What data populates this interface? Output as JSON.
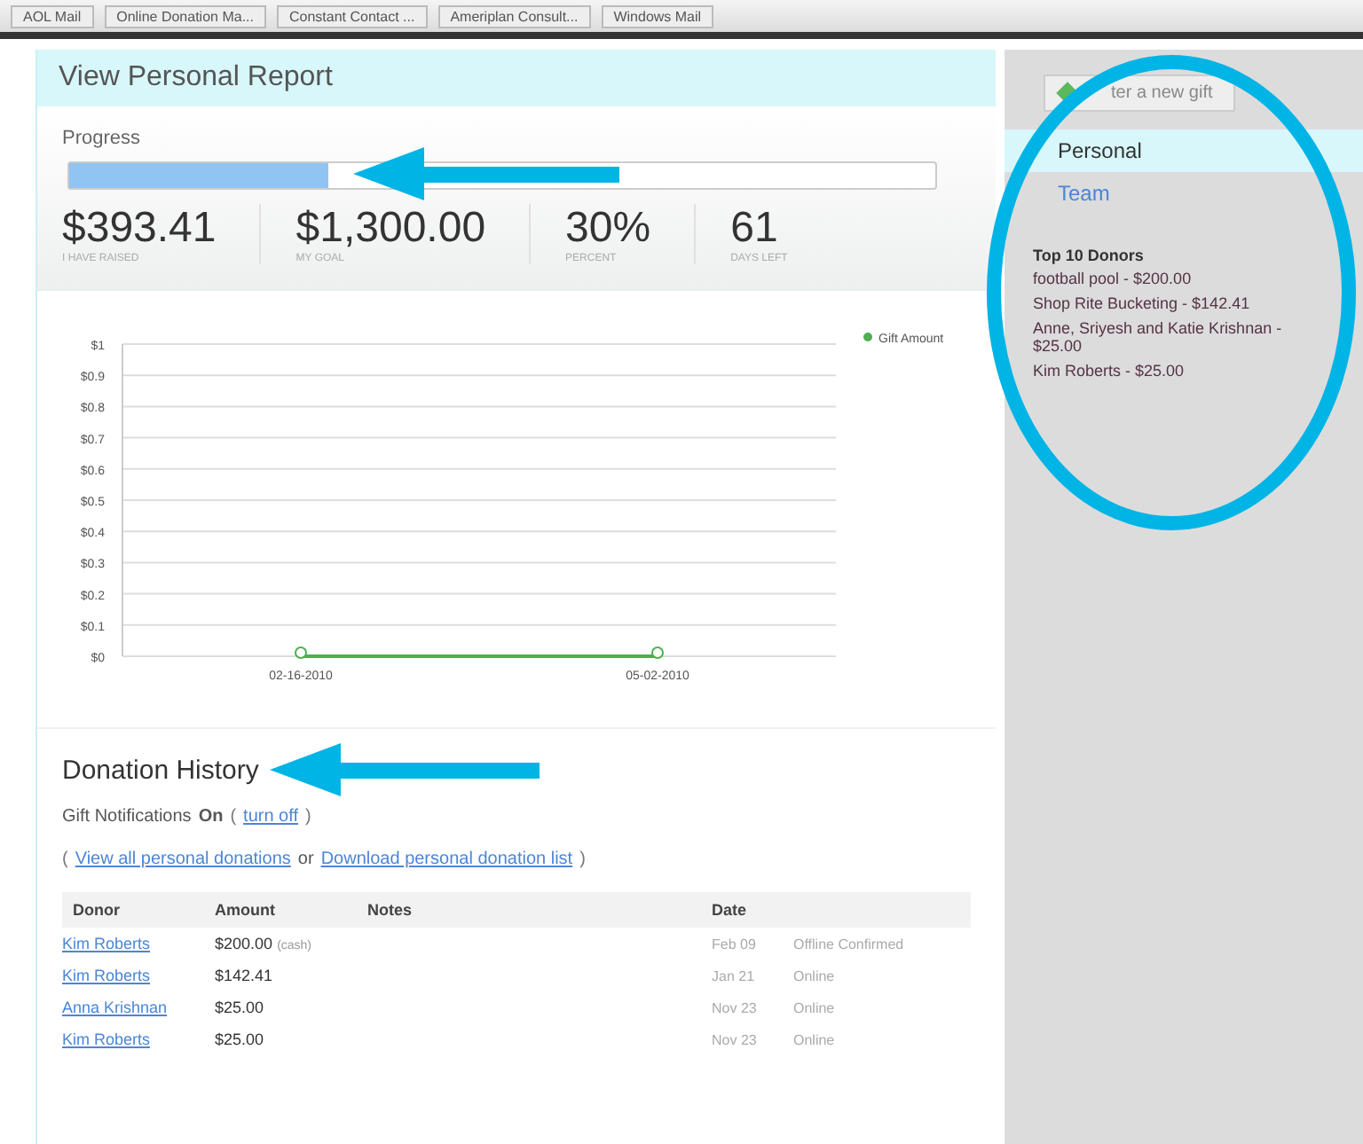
{
  "taskbar": {
    "tabs": [
      {
        "label": "AOL Mail"
      },
      {
        "label": "Online Donation Ma..."
      },
      {
        "label": "Constant Contact ..."
      },
      {
        "label": "Ameriplan Consult..."
      },
      {
        "label": "Windows Mail"
      }
    ]
  },
  "report": {
    "title": "View Personal Report",
    "progress_label": "Progress",
    "level": 0.3,
    "stats": [
      {
        "value": "$393.41",
        "label": "I HAVE RAISED"
      },
      {
        "value": "$1,300.00",
        "label": "MY GOAL"
      },
      {
        "value": "30%",
        "label": "PERCENT"
      },
      {
        "value": "61",
        "label": "DAYS LEFT"
      }
    ]
  },
  "chart": {
    "chart_data": {
      "type": "line",
      "grid": true,
      "categories": [
        "02-16-2010",
        "05-02-2010"
      ],
      "ylim": [
        0,
        1
      ],
      "yticks": [
        {
          "value": 0,
          "label": "$0"
        },
        {
          "value": 0.1,
          "label": "$0.1"
        },
        {
          "value": 0.2,
          "label": "$0.2"
        },
        {
          "value": 0.3,
          "label": "$0.3"
        },
        {
          "value": 0.4,
          "label": "$0.4"
        },
        {
          "value": 0.5,
          "label": "$0.5"
        },
        {
          "value": 0.6,
          "label": "$0.6"
        },
        {
          "value": 0.7,
          "label": "$0.7"
        },
        {
          "value": 0.8,
          "label": "$0.8"
        },
        {
          "value": 0.9,
          "label": "$0.9"
        },
        {
          "value": 1,
          "label": "$1"
        }
      ],
      "series": [
        {
          "name": "Gift Amount",
          "color": "#4caf50",
          "values": [
            0,
            0
          ]
        }
      ]
    }
  },
  "donation_history": {
    "title": "Donation History",
    "notifications_label": "Gift Notifications",
    "notifications_state": "On",
    "turn_off_open": "(",
    "turn_off_link": "turn off",
    "turn_off_close": ")",
    "links_open": "(",
    "links_close": ")",
    "view_all_link": "View all personal donations",
    "or_text": "or",
    "download_link": "Download personal donation list",
    "columns": [
      "Donor",
      "Amount",
      "Notes",
      "Date"
    ],
    "rows": [
      {
        "donor": "Kim Roberts",
        "amount": "$200.00",
        "amount_note": "(cash)",
        "date": "Feb 09",
        "status": "Offline Confirmed"
      },
      {
        "donor": "Kim Roberts",
        "amount": "$142.41",
        "date": "Jan 21",
        "status": "Online"
      },
      {
        "donor": "Anna Krishnan",
        "amount": "$25.00",
        "date": "Nov 23",
        "status": "Online"
      },
      {
        "donor": "Kim Roberts",
        "amount": "$25.00",
        "date": "Nov 23",
        "status": "Online"
      }
    ]
  },
  "sidebar": {
    "gift_button": "ter a new gift",
    "items": [
      {
        "label": "Personal",
        "selected": true
      },
      {
        "label": "Team",
        "selected": false
      }
    ],
    "top_donors_title": "Top 10 Donors",
    "top_donors": [
      "football pool - $200.00",
      "Shop Rite Bucketing - $142.41",
      "Anne, Sriyesh and Katie Krishnan - $25.00",
      "Kim Roberts - $25.00"
    ]
  }
}
